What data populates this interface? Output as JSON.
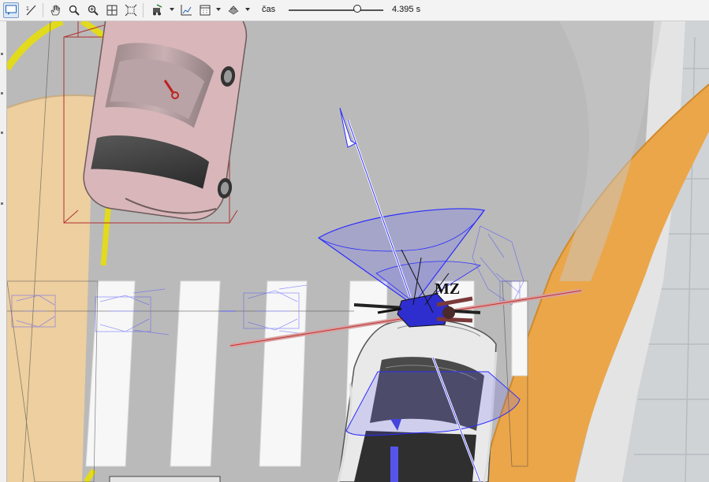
{
  "toolbar": {
    "tools": [
      {
        "name": "comment-icon",
        "active": true
      },
      {
        "name": "measure-icon"
      },
      {
        "name": "pan-hand-icon"
      },
      {
        "name": "zoom-icon"
      },
      {
        "name": "zoom-plus-icon"
      },
      {
        "name": "zoom-window-icon"
      },
      {
        "name": "fit-view-icon"
      },
      {
        "name": "simulation-icon"
      },
      {
        "name": "chart-icon"
      },
      {
        "name": "calendar-icon"
      },
      {
        "name": "render-icon"
      }
    ],
    "time_label": "čas",
    "time_value": "4.395 s",
    "time_fraction": 0.7
  },
  "scene": {
    "cyclist_label": "MZ",
    "colors": {
      "road": "#b9b9b9",
      "sidewalk_orange": "#eba64a",
      "sidewalk_beige": "#edcfa0",
      "lane_yellow": "#e2da1c",
      "crosswalk": "#f7f7f7",
      "pink_car": "#d8b6b9",
      "white_car": "#e9e9e9",
      "blue_wire": "#3a3aff",
      "red_line": "#d05050"
    }
  }
}
